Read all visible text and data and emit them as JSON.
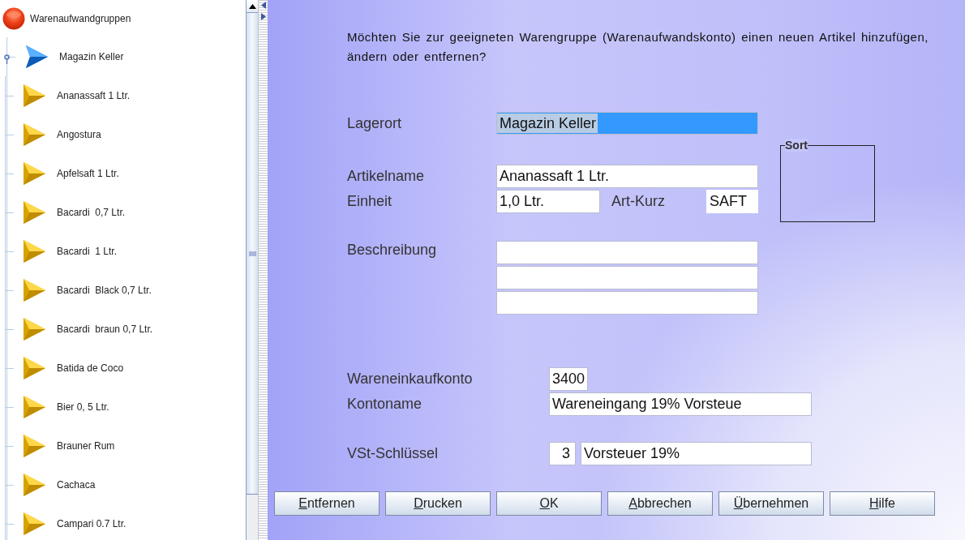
{
  "tree": {
    "kind": "root",
    "label": "Warenaufwandgruppen",
    "children": [
      {
        "kind": "group",
        "label": "Magazin Keller",
        "expanded": true,
        "children": [
          {
            "kind": "item",
            "label": "Ananassaft 1 Ltr."
          },
          {
            "kind": "item",
            "label": "Angostura"
          },
          {
            "kind": "item",
            "label": "Apfelsaft 1 Ltr."
          },
          {
            "kind": "item",
            "label": "Bacardi  0,7 Ltr."
          },
          {
            "kind": "item",
            "label": "Bacardi  1 Ltr."
          },
          {
            "kind": "item",
            "label": "Bacardi  Black 0,7 Ltr."
          },
          {
            "kind": "item",
            "label": "Bacardi  braun 0,7 Ltr."
          },
          {
            "kind": "item",
            "label": "Batida de Coco"
          },
          {
            "kind": "item",
            "label": "Bier 0, 5 Ltr."
          },
          {
            "kind": "item",
            "label": "Brauner Rum"
          },
          {
            "kind": "item",
            "label": "Cachaca"
          },
          {
            "kind": "item",
            "label": "Campari 0.7 Ltr."
          }
        ]
      }
    ]
  },
  "question": "Möchten Sie zur geeigneten Warengruppe (Warenaufwandskonto) einen neuen Artikel hinzufügen, ändern oder entfernen?",
  "lagerort": {
    "label": "Lagerort",
    "value": "Magazin Keller",
    "text_selected": true
  },
  "sort_group": {
    "title": "Sort"
  },
  "artikelname": {
    "label": "Artikelname",
    "value": "Ananassaft 1 Ltr."
  },
  "einheit": {
    "label": "Einheit",
    "value": "1,0 Ltr."
  },
  "art_kurz": {
    "label": "Art-Kurz",
    "value": "SAFT"
  },
  "beschreibung": {
    "label": "Beschreibung"
  },
  "wareneinkaufkonto": {
    "label": "Wareneinkaufkonto",
    "value": "3400"
  },
  "kontoname": {
    "label": "Kontoname",
    "value": "Wareneingang 19% Vorsteue"
  },
  "vst_schluessel": {
    "label": "VSt-Schlüssel",
    "code": "3",
    "text": "Vorsteuer 19%"
  },
  "buttons": [
    {
      "label": "Entfernen",
      "mnemonic": true
    },
    {
      "label": "Drucken",
      "mnemonic": true
    },
    {
      "label": "OK",
      "mnemonic": true
    },
    {
      "label": "Abbrechen",
      "mnemonic": true
    },
    {
      "label": "Übernehmen",
      "mnemonic": true
    },
    {
      "label": "Hilfe",
      "mnemonic": true
    }
  ]
}
